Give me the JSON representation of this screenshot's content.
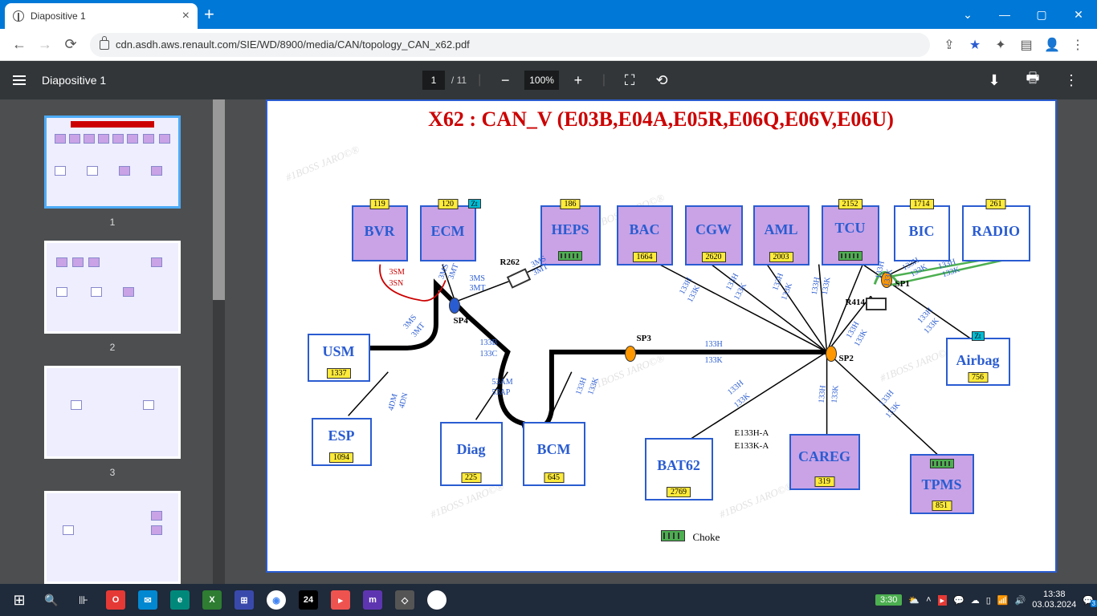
{
  "browser": {
    "tab_title": "Diapositive 1",
    "new_tab_glyph": "+",
    "back_glyph": "←",
    "fwd_glyph": "→",
    "reload_glyph": "⟳",
    "url": "cdn.asdh.aws.renault.com/SIE/WD/8900/media/CAN/topology_CAN_x62.pdf",
    "window_controls": {
      "down": "⌄",
      "min": "—",
      "max": "▢",
      "close": "✕"
    }
  },
  "viewer": {
    "doc_name": "Diapositive 1",
    "page_current": "1",
    "page_total": "11",
    "zoom": "100%",
    "minus_glyph": "−",
    "plus_glyph": "+",
    "fit_glyph": "⛶",
    "rotate_glyph": "⟲",
    "download_glyph": "⬇",
    "print_glyph": "🖶",
    "more_glyph": "⋮"
  },
  "thumbnails": {
    "items": [
      "1",
      "2",
      "3",
      ""
    ]
  },
  "diagram": {
    "title": "X62 : CAN_V (E03B,E04A,E05R,E06Q,E06V,E06U)",
    "nodes": {
      "bvr": {
        "label": "BVR",
        "code": "119"
      },
      "ecm": {
        "label": "ECM",
        "code": "120",
        "zt": "Zt"
      },
      "heps": {
        "label": "HEPS",
        "code": "186"
      },
      "bac": {
        "label": "BAC",
        "code": "1664"
      },
      "cgw": {
        "label": "CGW",
        "code": "2620"
      },
      "aml": {
        "label": "AML",
        "code": "2003"
      },
      "tcu": {
        "label": "TCU",
        "code": "2152"
      },
      "bic": {
        "label": "BIC",
        "code": "1714"
      },
      "radio": {
        "label": "RADIO",
        "code": "261"
      },
      "usm": {
        "label": "USM",
        "code": "1337"
      },
      "esp": {
        "label": "ESP",
        "code": "1094"
      },
      "diag": {
        "label": "Diag",
        "code": "225"
      },
      "bcm": {
        "label": "BCM",
        "code": "645"
      },
      "bat62": {
        "label": "BAT62",
        "code": "2769"
      },
      "careg": {
        "label": "CAREG",
        "code": "319"
      },
      "airbag": {
        "label": "Airbag",
        "code": "756",
        "zt": "Zt"
      },
      "tpms": {
        "label": "TPMS",
        "code": "851"
      }
    },
    "splice": {
      "sp1": "SP1",
      "sp2": "SP2",
      "sp3": "SP3",
      "sp4": "SP4"
    },
    "connectors": {
      "r262": "R262",
      "r414": "R414"
    },
    "wires": {
      "w3sm": "3SM",
      "w3sn": "3SN",
      "w3ms": "3MS",
      "w3mt": "3MT",
      "w133b": "133B",
      "w133c": "133C",
      "w133h": "133H",
      "w133k": "133K",
      "w53am": "53AM",
      "w53ap": "53AP",
      "w4dm": "4DM",
      "w4dn": "4DN",
      "e133h": "E133H-A",
      "e133k": "E133K-A"
    },
    "legend": {
      "choke": "Choke"
    },
    "watermark": "#1BOSS JARO©®"
  },
  "taskbar": {
    "start_glyph": "⊞",
    "search_glyph": "🔍",
    "cortana_glyph": "◯",
    "task_glyph": "⧉",
    "battery_time": "3:30",
    "time": "13:38",
    "date": "03.03.2024",
    "notif_count": "3"
  }
}
